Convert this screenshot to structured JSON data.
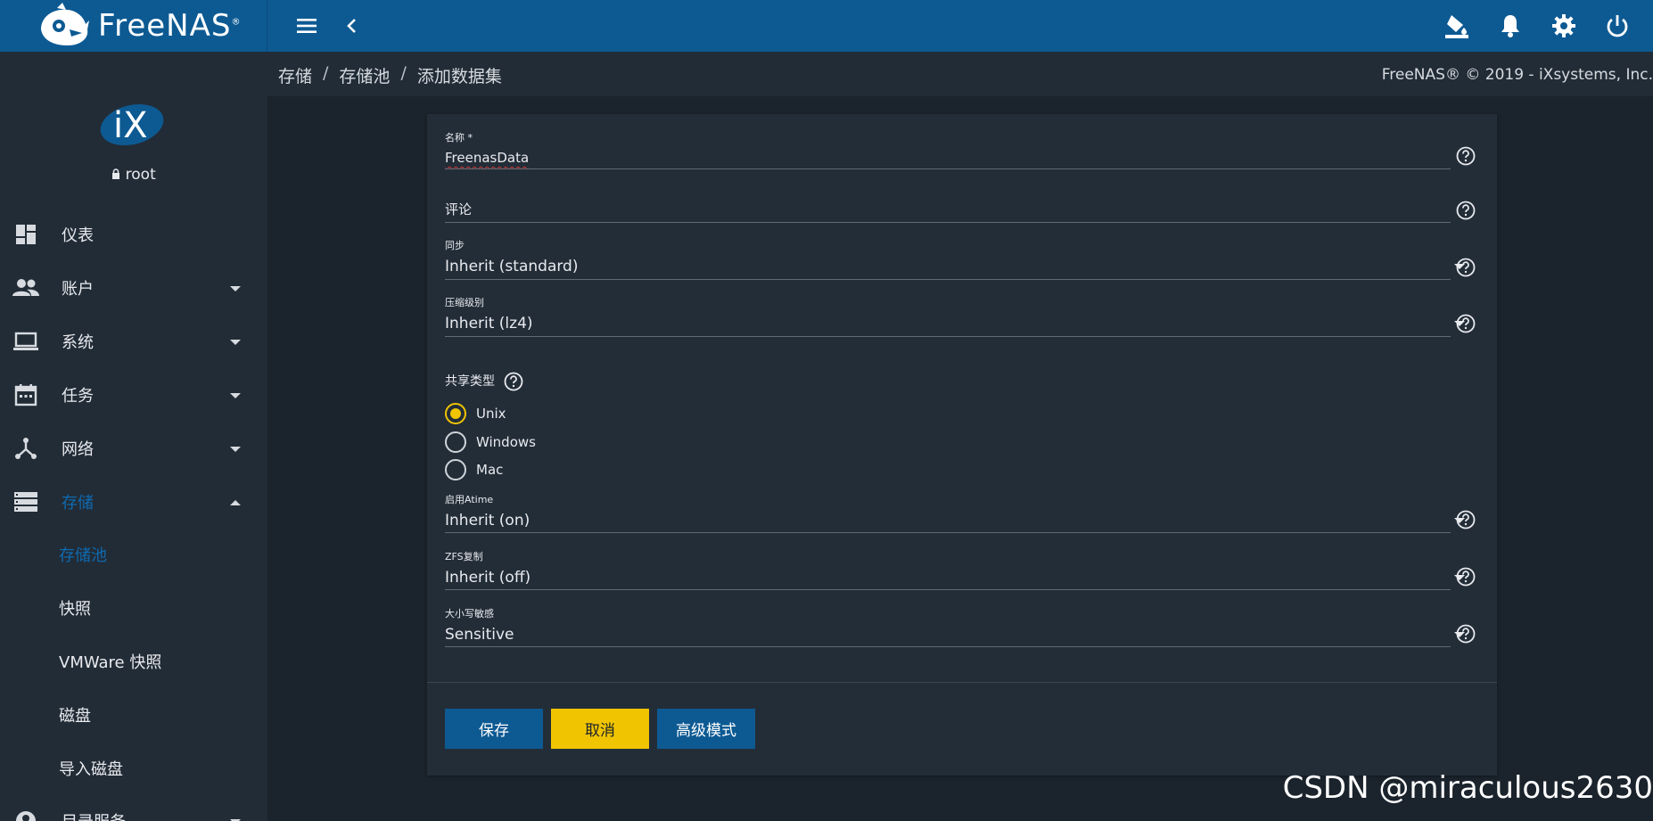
{
  "app": {
    "logo_text": "FreeNAS",
    "logo_mark": "®"
  },
  "sidebar": {
    "user": "root",
    "items": [
      {
        "label": "仪表",
        "icon": "dashboard-icon",
        "has_caret": false
      },
      {
        "label": "账户",
        "icon": "accounts-icon",
        "has_caret": true
      },
      {
        "label": "系统",
        "icon": "laptop-icon",
        "has_caret": true
      },
      {
        "label": "任务",
        "icon": "calendar-icon",
        "has_caret": true
      },
      {
        "label": "网络",
        "icon": "network-icon",
        "has_caret": true
      },
      {
        "label": "存储",
        "icon": "storage-icon",
        "has_caret": true,
        "expanded": true
      },
      {
        "label": "目录服务",
        "icon": "directory-icon",
        "has_caret": true
      }
    ],
    "storage_sub": [
      "存储池",
      "快照",
      "VMWare 快照",
      "磁盘",
      "导入磁盘"
    ]
  },
  "breadcrumb": {
    "items": [
      "存储",
      "存储池",
      "添加数据集"
    ],
    "separator": "/"
  },
  "copyright": "FreeNAS® © 2019 - iXsystems, Inc.",
  "form": {
    "name": {
      "label": "名称 *",
      "value": "FreenasData"
    },
    "comment": {
      "placeholder": "评论"
    },
    "sync": {
      "label": "同步",
      "value": "Inherit (standard)"
    },
    "compression": {
      "label": "压缩级别",
      "value": "Inherit (lz4)"
    },
    "share_type": {
      "label": "共享类型",
      "options": [
        "Unix",
        "Windows",
        "Mac"
      ],
      "selected": "Unix"
    },
    "atime": {
      "label": "启用Atime",
      "value": "Inherit (on)"
    },
    "zfs_dedup": {
      "label": "ZFS复制",
      "value": "Inherit (off)"
    },
    "case": {
      "label": "大小写敏感",
      "value": "Sensitive"
    }
  },
  "buttons": {
    "save": "保存",
    "cancel": "取消",
    "advanced": "高级模式"
  },
  "watermark": "CSDN @miraculous2630",
  "colors": {
    "topbar": "#0d5a93",
    "accent": "#0e6ab0",
    "yellow": "#f0c400",
    "sidebar": "#222c37",
    "bg": "#1b232c"
  }
}
